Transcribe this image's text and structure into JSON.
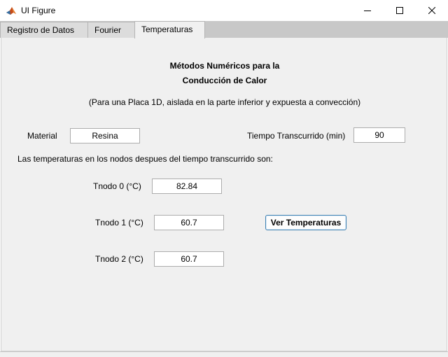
{
  "window": {
    "title": "UI Figure",
    "controls": {
      "minimize": "minimize",
      "maximize": "maximize",
      "close": "close"
    }
  },
  "tabs": [
    {
      "label": "Registro de Datos",
      "selected": false
    },
    {
      "label": "Fourier",
      "selected": false
    },
    {
      "label": "Temperaturas",
      "selected": true
    }
  ],
  "panel": {
    "heading_line1": "Métodos Numéricos para la",
    "heading_line2": "Conducción de Calor",
    "subtitle": "(Para una Placa 1D, aislada en la parte inferior y expuesta a convección)",
    "material_label": "Material",
    "material_value": "Resina",
    "tiempo_label": "Tiempo Transcurrido (min)",
    "tiempo_value": "90",
    "nodes_intro": "Las temperaturas en los nodos despues del tiempo transcurrido son:",
    "nodes": [
      {
        "label": "Tnodo 0 (°C)",
        "value": "82.84"
      },
      {
        "label": "Tnodo 1 (°C)",
        "value": "60.7"
      },
      {
        "label": "Tnodo 2 (°C)",
        "value": "60.7"
      }
    ],
    "ver_button": "Ver Temperaturas"
  },
  "colors": {
    "panel_bg": "#f0f0f0",
    "tabstrip_bg": "#c8c8c8",
    "button_border": "#3c7fb1"
  }
}
